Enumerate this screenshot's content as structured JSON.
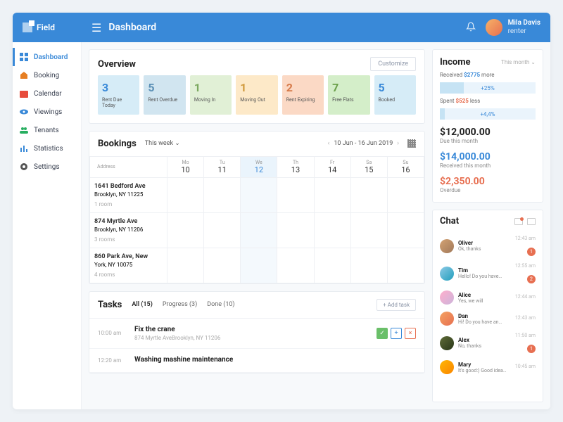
{
  "app_name": "Field",
  "page_title": "Dashboard",
  "user": {
    "name": "Mila Davis",
    "role": "renter"
  },
  "sidebar": {
    "items": [
      {
        "label": "Dashboard",
        "icon": "grid"
      },
      {
        "label": "Booking",
        "icon": "home"
      },
      {
        "label": "Calendar",
        "icon": "calendar"
      },
      {
        "label": "Viewings",
        "icon": "eye"
      },
      {
        "label": "Tenants",
        "icon": "people"
      },
      {
        "label": "Statistics",
        "icon": "bars"
      },
      {
        "label": "Settings",
        "icon": "gear"
      }
    ]
  },
  "overview": {
    "title": "Overview",
    "customize_label": "Customize",
    "stats": [
      {
        "value": "3",
        "label": "Rent Due Today"
      },
      {
        "value": "5",
        "label": "Rent Overdue"
      },
      {
        "value": "1",
        "label": "Moving In"
      },
      {
        "value": "1",
        "label": "Moving Out"
      },
      {
        "value": "2",
        "label": "Rent Expiring"
      },
      {
        "value": "7",
        "label": "Free Flats"
      },
      {
        "value": "5",
        "label": "Booked"
      }
    ]
  },
  "bookings": {
    "title": "Bookings",
    "period_label": "This week",
    "date_range": "10 Jun - 16 Jun 2019",
    "address_header": "Address",
    "days": [
      {
        "dow": "Mo",
        "num": "10"
      },
      {
        "dow": "Tu",
        "num": "11"
      },
      {
        "dow": "We",
        "num": "12",
        "current": true
      },
      {
        "dow": "Th",
        "num": "13"
      },
      {
        "dow": "Fr",
        "num": "14"
      },
      {
        "dow": "Sa",
        "num": "15"
      },
      {
        "dow": "Su",
        "num": "16"
      }
    ],
    "rows": [
      {
        "addr1": "1641 Bedford Ave",
        "addr2": "Brooklyn, NY 11225",
        "rooms": "1 room"
      },
      {
        "addr1": "874 Myrtle Ave",
        "addr2": "Brooklyn, NY 11206",
        "rooms": "3 rooms"
      },
      {
        "addr1": "860 Park Ave, New",
        "addr2": "York, NY 10075",
        "rooms": "4 rooms"
      }
    ]
  },
  "tasks": {
    "title": "Tasks",
    "tabs": [
      {
        "label": "All (15)"
      },
      {
        "label": "Progress (3)"
      },
      {
        "label": "Done (10)"
      }
    ],
    "add_label": "+ Add task",
    "items": [
      {
        "time": "10:00 am",
        "title": "Fix the crane",
        "sub": "874 Myrtle AveBrooklyn, NY 11206"
      },
      {
        "time": "12:20 am",
        "title": "Washing mashine maintenance",
        "sub": ""
      }
    ]
  },
  "income": {
    "title": "Income",
    "period_label": "This month",
    "received_label": "Received",
    "received_amount": "$2775",
    "received_more": "more",
    "received_pct": "+25%",
    "spent_label": "Spent",
    "spent_amount": "$525",
    "spent_less": "less",
    "spent_pct": "+4,4%",
    "amounts": [
      {
        "value": "$12,000.00",
        "label": "Due this month",
        "cls": ""
      },
      {
        "value": "$14,000.00",
        "label": "Received this month",
        "cls": "blue"
      },
      {
        "value": "$2,350.00",
        "label": "Overdue",
        "cls": "red"
      }
    ]
  },
  "chat": {
    "title": "Chat",
    "items": [
      {
        "name": "Oliver",
        "msg": "Ok, thanks",
        "time": "12:43 am",
        "badge": "1"
      },
      {
        "name": "Tim",
        "msg": "Hello! Do you have…",
        "time": "12:55 am",
        "badge": "2"
      },
      {
        "name": "Alice",
        "msg": "Yes, we will",
        "time": "12:44 am",
        "badge": ""
      },
      {
        "name": "Dan",
        "msg": "Hi! Do you have an…",
        "time": "12:43 am",
        "badge": ""
      },
      {
        "name": "Alex",
        "msg": "No, thanks",
        "time": "11:50 am",
        "badge": "1"
      },
      {
        "name": "Mary",
        "msg": "It's good:) Good idea…",
        "time": "10:45 am",
        "badge": ""
      }
    ]
  }
}
